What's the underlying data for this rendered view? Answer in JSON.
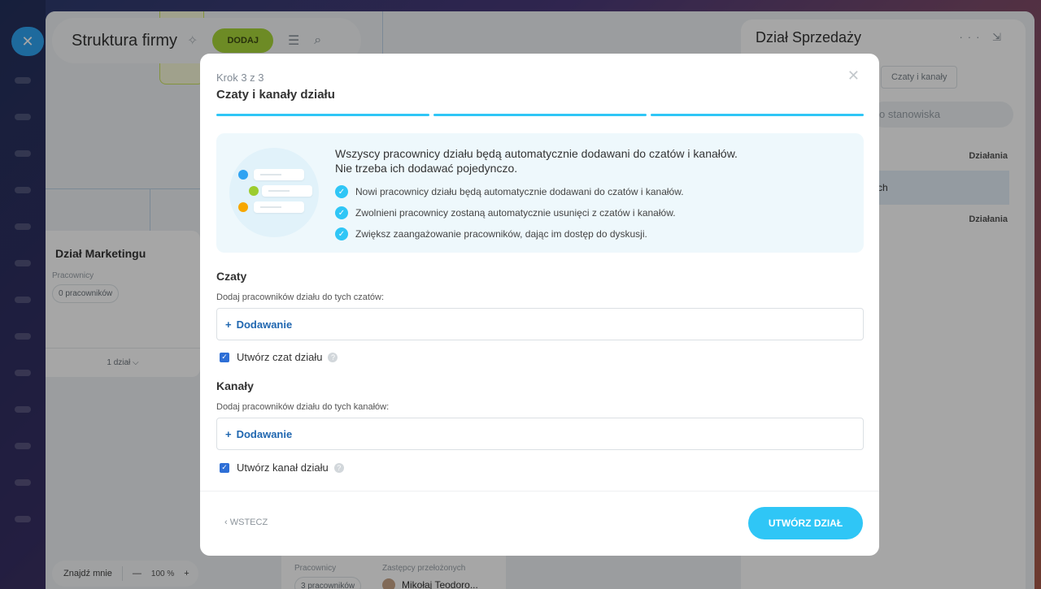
{
  "header": {
    "title": "Struktura firmy",
    "add_label": "DODAJ"
  },
  "org_chart": {
    "dept_card": {
      "title": "Dział Marketingu",
      "employees_label": "Pracownicy",
      "employees_count": "0 pracowników",
      "footer": "1 dział ⌵"
    },
    "bottom_card": {
      "employees_label": "Pracownicy",
      "deputies_label": "Zastępcy przełożonych",
      "employees_count": "3 pracowników",
      "deputy_name": "Mikołaj Teodoro..."
    },
    "find_bar": {
      "find_label": "Znajdź mnie",
      "zoom_minus": "—",
      "zoom_value": "100 %",
      "zoom_plus": "+"
    }
  },
  "side_panel": {
    "title": "Dział Sprzedaży",
    "tab_label": "Czaty i kanały",
    "search_placeholder": "o stanowiska",
    "action_label_1": "Działania",
    "row_text": "ch",
    "action_label_2": "Działania"
  },
  "modal": {
    "step": "Krok 3 z 3",
    "title": "Czaty i kanały działu",
    "info": {
      "heading_line1": "Wszyscy pracownicy działu będą automatycznie dodawani do czatów i kanałów.",
      "heading_line2": "Nie trzeba ich dodawać pojedynczo.",
      "items": [
        "Nowi pracownicy działu będą automatycznie dodawani do czatów i kanałów.",
        "Zwolnieni pracownicy zostaną automatycznie usunięci z czatów i kanałów.",
        "Zwiększ zaangażowanie pracowników, dając im dostęp do dyskusji."
      ]
    },
    "chats": {
      "title": "Czaty",
      "subtitle": "Dodaj pracowników działu do tych czatów:",
      "add_label": "Dodawanie",
      "checkbox_label": "Utwórz czat działu",
      "checked": true
    },
    "channels": {
      "title": "Kanały",
      "subtitle": "Dodaj pracowników działu do tych kanałów:",
      "add_label": "Dodawanie",
      "checkbox_label": "Utwórz kanał działu",
      "checked": true
    },
    "back_label": "‹ WSTECZ",
    "create_label": "UTWÓRZ DZIAŁ",
    "progress_steps": 3,
    "progress_done": 3
  },
  "colors": {
    "accent": "#2fc6f6",
    "add_button": "#a8d63a",
    "link": "#2067b0"
  },
  "icons": [
    "close-icon",
    "pin-icon",
    "menu-icon",
    "search-icon",
    "more-icon",
    "collapse-icon",
    "check-icon",
    "help-icon",
    "plus-icon"
  ]
}
